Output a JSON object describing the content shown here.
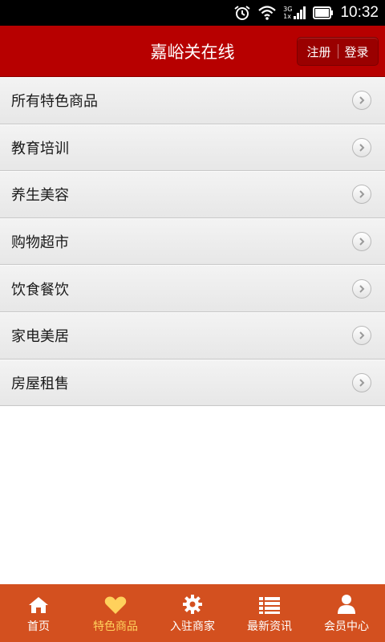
{
  "status_bar": {
    "network": "3G",
    "network_sub": "1x",
    "time": "10:32"
  },
  "header": {
    "title": "嘉峪关在线",
    "register_label": "注册",
    "login_label": "登录"
  },
  "menu": {
    "items": [
      {
        "label": "所有特色商品"
      },
      {
        "label": "教育培训"
      },
      {
        "label": "养生美容"
      },
      {
        "label": "购物超市"
      },
      {
        "label": "饮食餐饮"
      },
      {
        "label": "家电美居"
      },
      {
        "label": "房屋租售"
      }
    ]
  },
  "tabbar": {
    "tabs": [
      {
        "label": "首页",
        "icon": "home-icon"
      },
      {
        "label": "特色商品",
        "icon": "heart-icon",
        "active": true
      },
      {
        "label": "入驻商家",
        "icon": "gear-icon"
      },
      {
        "label": "最新资讯",
        "icon": "list-icon"
      },
      {
        "label": "会员中心",
        "icon": "user-icon"
      }
    ]
  },
  "colors": {
    "header_bg": "#b70000",
    "tabbar_bg": "#d3501f",
    "active_tab": "#ffd15c"
  }
}
